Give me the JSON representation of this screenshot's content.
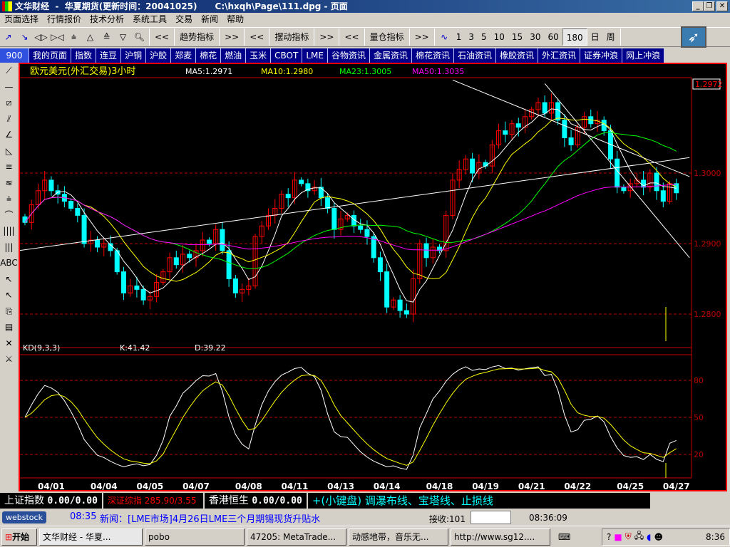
{
  "window": {
    "title": "文华财经  -  华夏期货(更新时间：20041025)      C:\\hxqh\\Page\\111.dpg - 页面"
  },
  "menu": [
    "页面选择",
    "行情报价",
    "技术分析",
    "系统工具",
    "交易",
    "新闻",
    "帮助"
  ],
  "toolbar": {
    "trend_label": "趋势指标",
    "swing_label": "摆动指标",
    "volume_label": "量仓指标",
    "prev": "<<",
    "next": ">>",
    "periods": [
      "1",
      "3",
      "5",
      "10",
      "15",
      "30",
      "60",
      "180",
      "日",
      "周"
    ],
    "selected_period": "180"
  },
  "tabs": [
    "900",
    "我的页面",
    "指数",
    "连豆",
    "沪铜",
    "沪胶",
    "郑麦",
    "棉花",
    "燃油",
    "玉米",
    "CBOT",
    "LME",
    "谷物资讯",
    "金属资讯",
    "棉花资讯",
    "石油资讯",
    "橡胶资讯",
    "外汇资讯",
    "证券冲浪",
    "网上冲浪"
  ],
  "left_tools": [
    "⟋",
    "—",
    "⧄",
    "⫽",
    "∠",
    "◺",
    "≡",
    "≋",
    "⩮",
    "⌒",
    "||||",
    "|||",
    "ABC",
    "↖",
    "↖",
    "⎘",
    "▤",
    "✕",
    "⚔"
  ],
  "chart_data": {
    "type": "candlestick",
    "title": "欧元美元(外汇交易)3小时",
    "ma_labels": [
      {
        "text": "MA5:1.2971",
        "color": "#ffffff",
        "period": 5
      },
      {
        "text": "MA10:1.2980",
        "color": "#ffff00",
        "period": 10
      },
      {
        "text": "MA23:1.3005",
        "color": "#00ff00",
        "period": 23
      },
      {
        "text": "MA50:1.3035",
        "color": "#ff00ff",
        "period": 50
      }
    ],
    "last_price": "1.2972",
    "price_ticks": [
      "1.3000",
      "1.2900",
      "1.2800"
    ],
    "price_tick_values": [
      1.3,
      1.29,
      1.28
    ],
    "ylim": [
      1.2755,
      1.3155
    ],
    "closes": [
      1.293,
      1.2955,
      1.2975,
      1.299,
      1.2975,
      1.297,
      1.296,
      1.295,
      1.294,
      1.29,
      1.2905,
      1.2895,
      1.29,
      1.289,
      1.286,
      1.283,
      1.284,
      1.2835,
      1.282,
      1.2825,
      1.2845,
      1.286,
      1.288,
      1.287,
      1.2885,
      1.288,
      1.289,
      1.2905,
      1.29,
      1.292,
      1.289,
      1.285,
      1.283,
      1.2835,
      1.284,
      1.291,
      1.2925,
      1.294,
      1.295,
      1.297,
      1.2965,
      1.299,
      1.2985,
      1.2975,
      1.298,
      1.2965,
      1.295,
      1.292,
      1.2935,
      1.294,
      1.2925,
      1.292,
      1.291,
      1.288,
      1.286,
      1.281,
      1.282,
      1.2805,
      1.28,
      1.285,
      1.29,
      1.288,
      1.2895,
      1.289,
      1.294,
      1.299,
      1.3005,
      1.302,
      1.3,
      1.3015,
      1.301,
      1.304,
      1.306,
      1.3055,
      1.307,
      1.3065,
      1.308,
      1.309,
      1.31,
      1.3085,
      1.31,
      1.3075,
      1.305,
      1.304,
      1.3065,
      1.308,
      1.307,
      1.3075,
      1.306,
      1.302,
      1.298,
      1.2975,
      1.2985,
      1.299,
      1.298,
      1.3,
      1.2975,
      1.296,
      1.2985,
      1.2972
    ],
    "trend_lines": [
      [
        -1,
        1.289,
        101,
        1.3022
      ],
      [
        65,
        1.3132,
        101,
        1.2995
      ],
      [
        79,
        1.3127,
        101,
        1.288
      ]
    ],
    "kd": {
      "label": "KD(9,3,3)",
      "k_label": "K:41.42",
      "d_label": "D:39.22",
      "ticks": [
        "80",
        "50",
        "20"
      ],
      "tick_values": [
        80,
        50,
        20
      ]
    },
    "dates": [
      {
        "i": 4,
        "label": "04/01"
      },
      {
        "i": 12,
        "label": "04/04"
      },
      {
        "i": 19,
        "label": "04/05"
      },
      {
        "i": 26,
        "label": "04/07"
      },
      {
        "i": 34,
        "label": "04/08"
      },
      {
        "i": 41,
        "label": "04/11"
      },
      {
        "i": 48,
        "label": "04/13"
      },
      {
        "i": 55,
        "label": "04/14"
      },
      {
        "i": 63,
        "label": "04/18"
      },
      {
        "i": 70,
        "label": "04/19"
      },
      {
        "i": 77,
        "label": "04/21"
      },
      {
        "i": 84,
        "label": "04/22"
      },
      {
        "i": 92,
        "label": "04/25"
      },
      {
        "i": 99,
        "label": "04/27"
      }
    ],
    "up_color": "#ff0000",
    "down_color": "#00ffff"
  },
  "ticker": {
    "sh_label": "上证指数",
    "sh_value": "0.00/0.00",
    "sz_label": "深证综指",
    "sz_value": "285.90/3.55",
    "hk_label": "香港恒生",
    "hk_value": "0.00/0.00",
    "tip": "+(小键盘)  调瀑布线、宝塔线、止损线"
  },
  "news": {
    "logo": "webstock",
    "time": "08:35",
    "text": "新闻：[LME市场]4月26日LME三个月期锡现货升贴水",
    "recv_label": "接收:101",
    "clock": "08:36:09"
  },
  "taskbar": {
    "start": "开始",
    "tasks": [
      "文华财经 - 华夏...",
      "pobo",
      "47205: MetaTrade...",
      "动感地带，音乐无...",
      "http://www.sg12...."
    ],
    "clock": "8:36"
  }
}
